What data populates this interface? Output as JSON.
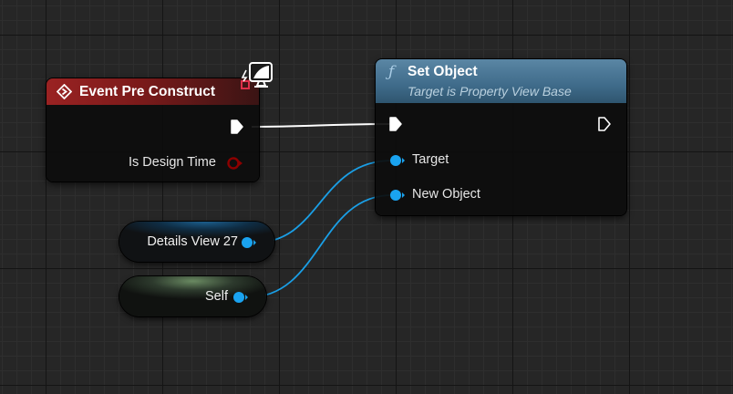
{
  "nodes": {
    "event": {
      "title": "Event Pre Construct",
      "pins": {
        "design_time": "Is Design Time"
      }
    },
    "set_object": {
      "title": "Set Object",
      "subtitle": "Target is Property View Base",
      "pins": {
        "target": "Target",
        "new_object": "New Object"
      }
    },
    "details_view": {
      "label": "Details View 27"
    },
    "self": {
      "label": "Self"
    }
  },
  "colors": {
    "event_header": "#9a2222",
    "function_header": "#3f6b8a",
    "object_pin": "#1aa3f0",
    "bool_pin": "#8c0000",
    "exec_wire": "#ffffff",
    "object_wire": "#1a9fe6"
  },
  "icons": {
    "event": "event-diamond-icon",
    "function": "function-icon",
    "client_only": "client-monitor-icon"
  }
}
